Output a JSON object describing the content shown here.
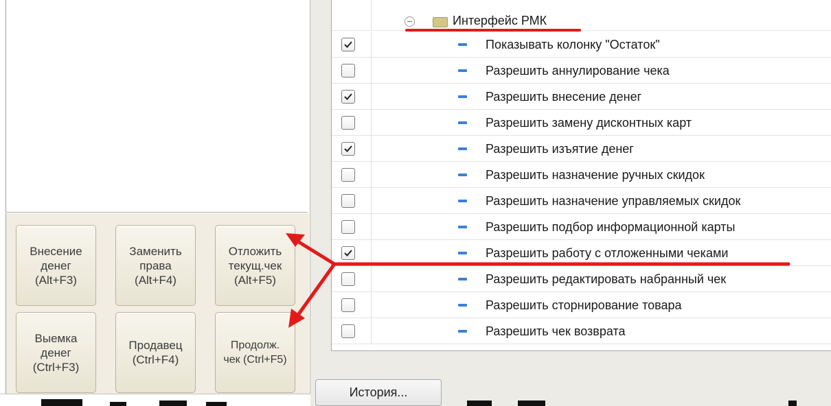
{
  "left": {
    "buttons": [
      {
        "label": "Внесение\nденег\n(Alt+F3)"
      },
      {
        "label": "Заменить\nправа\n(Alt+F4)"
      },
      {
        "label": "Отложить\nтекущ.чек\n(Alt+F5)"
      },
      {
        "label": "Выемка\nденег\n(Ctrl+F3)"
      },
      {
        "label": "Продавец\n(Ctrl+F4)"
      },
      {
        "label": "Продолж.\nчек (Ctrl+F5)"
      }
    ]
  },
  "settings": {
    "group_label": "Интерфейс РМК",
    "rows": [
      {
        "label": "Показывать колонку \"Остаток\"",
        "checked": true
      },
      {
        "label": "Разрешить аннулирование чека",
        "checked": false
      },
      {
        "label": "Разрешить внесение денег",
        "checked": true
      },
      {
        "label": "Разрешить замену дисконтных карт",
        "checked": false
      },
      {
        "label": "Разрешить изъятие денег",
        "checked": true
      },
      {
        "label": "Разрешить назначение ручных скидок",
        "checked": false
      },
      {
        "label": "Разрешить назначение управляемых скидок",
        "checked": false
      },
      {
        "label": "Разрешить подбор информационной карты",
        "checked": false
      },
      {
        "label": "Разрешить работу с отложенными чеками",
        "checked": true
      },
      {
        "label": "Разрешить редактировать набранный чек",
        "checked": false
      },
      {
        "label": "Разрешить сторнирование товара",
        "checked": false
      },
      {
        "label": "Разрешить чек возврата",
        "checked": false
      }
    ]
  },
  "footer": {
    "history_label": "История..."
  },
  "colors": {
    "annotation": "#e41a1a",
    "dash": "#3d7fd6"
  }
}
